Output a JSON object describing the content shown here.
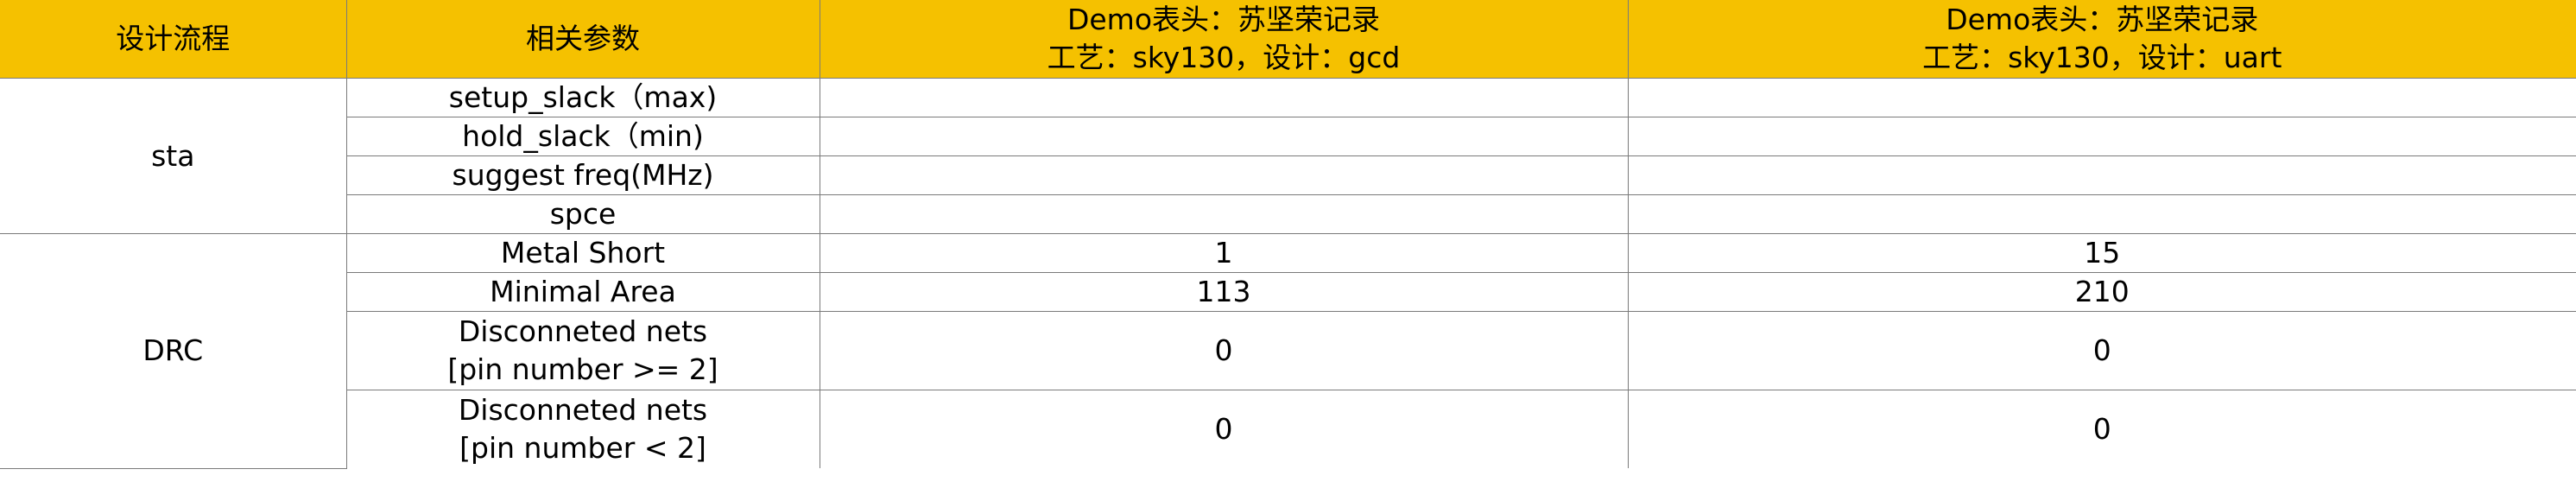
{
  "header": {
    "col1": "设计流程",
    "col2": "相关参数",
    "col3_line1": "Demo表头：苏坚荣记录",
    "col3_line2": "工艺：sky130，设计：gcd",
    "col4_line1": "Demo表头：苏坚荣记录",
    "col4_line2": "工艺：sky130，设计：uart"
  },
  "colors": {
    "header_background": "#f5c100",
    "grid_line": "#7a7a7a"
  },
  "groups": [
    {
      "name": "sta",
      "rows": [
        {
          "param": "setup_slack（max)",
          "gcd": "",
          "uart": ""
        },
        {
          "param": "hold_slack（min)",
          "gcd": "",
          "uart": ""
        },
        {
          "param": "suggest freq(MHz)",
          "gcd": "",
          "uart": ""
        },
        {
          "param": "spce",
          "gcd": "",
          "uart": ""
        }
      ]
    },
    {
      "name": "DRC",
      "rows": [
        {
          "param": "Metal Short",
          "gcd": "1",
          "uart": "15"
        },
        {
          "param": "Minimal Area",
          "gcd": "113",
          "uart": "210"
        },
        {
          "param_line1": "Disconneted nets",
          "param_line2": "[pin number >= 2]",
          "gcd": "0",
          "uart": "0"
        },
        {
          "param_line1": "Disconneted nets",
          "param_line2": "[pin number < 2]",
          "gcd": "0",
          "uart": "0"
        }
      ]
    }
  ]
}
